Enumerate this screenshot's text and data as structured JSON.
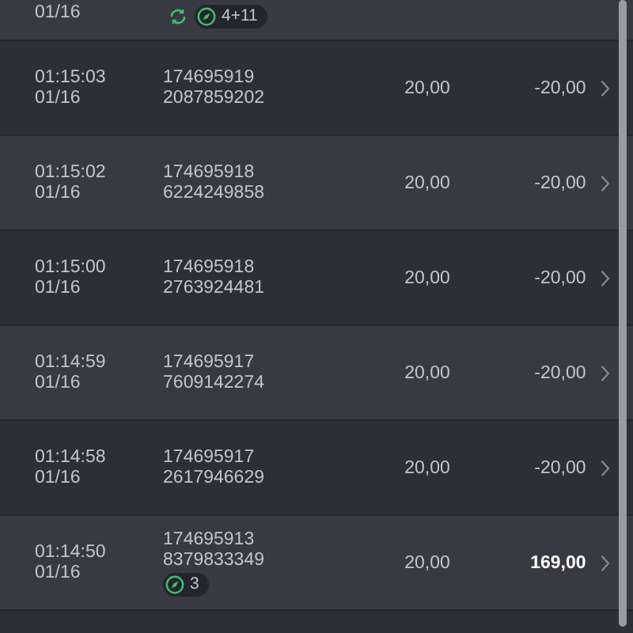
{
  "partial_top": {
    "date": "01/16",
    "badges": [
      {
        "kind": "sync"
      },
      {
        "kind": "compass",
        "text": "4+11"
      }
    ]
  },
  "rows": [
    {
      "time": "01:15:03",
      "date": "01/16",
      "order": "174695919",
      "ticket": "2087859202",
      "stake": "20,00",
      "result": "-20,00",
      "win": false,
      "badges": []
    },
    {
      "time": "01:15:02",
      "date": "01/16",
      "order": "174695918",
      "ticket": "6224249858",
      "stake": "20,00",
      "result": "-20,00",
      "win": false,
      "badges": []
    },
    {
      "time": "01:15:00",
      "date": "01/16",
      "order": "174695918",
      "ticket": "2763924481",
      "stake": "20,00",
      "result": "-20,00",
      "win": false,
      "badges": []
    },
    {
      "time": "01:14:59",
      "date": "01/16",
      "order": "174695917",
      "ticket": "7609142274",
      "stake": "20,00",
      "result": "-20,00",
      "win": false,
      "badges": []
    },
    {
      "time": "01:14:58",
      "date": "01/16",
      "order": "174695917",
      "ticket": "2617946629",
      "stake": "20,00",
      "result": "-20,00",
      "win": false,
      "badges": []
    },
    {
      "time": "01:14:50",
      "date": "01/16",
      "order": "174695913",
      "ticket": "8379833349",
      "stake": "20,00",
      "result": "169,00",
      "win": true,
      "badges": [
        {
          "kind": "compass",
          "text": "3"
        }
      ]
    }
  ]
}
